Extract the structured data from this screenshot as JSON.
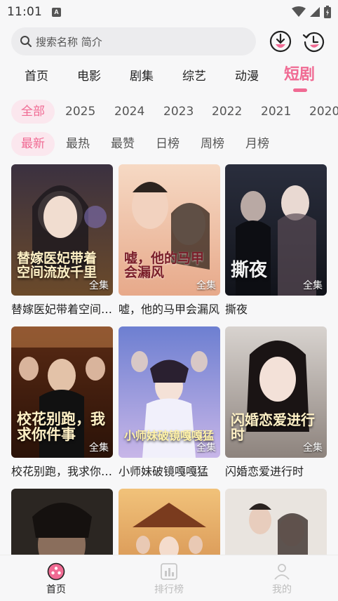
{
  "status_bar": {
    "time": "11:01",
    "notif": "A"
  },
  "search": {
    "placeholder": "搜索名称 简介"
  },
  "tabs": [
    {
      "label": "首页"
    },
    {
      "label": "电影"
    },
    {
      "label": "剧集"
    },
    {
      "label": "综艺"
    },
    {
      "label": "动漫"
    },
    {
      "label": "短剧"
    }
  ],
  "year_filters": [
    "全部",
    "2025",
    "2024",
    "2023",
    "2022",
    "2021",
    "2020"
  ],
  "sort_filters": [
    "最新",
    "最热",
    "最赞",
    "日榜",
    "周榜",
    "月榜"
  ],
  "cards": [
    {
      "title": "替嫁医妃带着空间流放千里",
      "badge": "全集",
      "art": "替嫁医妃带着空间流放千里"
    },
    {
      "title": "嘘，他的马甲会漏风",
      "badge": "全集",
      "art": "嘘，他的马甲会漏风"
    },
    {
      "title": "撕夜",
      "badge": "全集",
      "art": "撕夜"
    },
    {
      "title": "校花别跑，我求你件事",
      "badge": "全集",
      "art": "校花别跑，我求你件事"
    },
    {
      "title": "小师妹破镜嘎嘎猛",
      "badge": "全集",
      "art": "小师妹破镜嘎嘎猛"
    },
    {
      "title": "闪婚恋爱进行时",
      "badge": "全集",
      "art": "闪婚恋爱进行时"
    },
    {
      "title": "",
      "badge": "",
      "art": ""
    },
    {
      "title": "",
      "badge": "",
      "art": ""
    },
    {
      "title": "",
      "badge": "",
      "art": ""
    }
  ],
  "bottom_nav": [
    {
      "label": "首页"
    },
    {
      "label": "排行榜"
    },
    {
      "label": "我的"
    }
  ],
  "colors": {
    "accent": "#f06a93",
    "chip_bg": "#fbe7ee",
    "search_bg": "#ececee"
  }
}
